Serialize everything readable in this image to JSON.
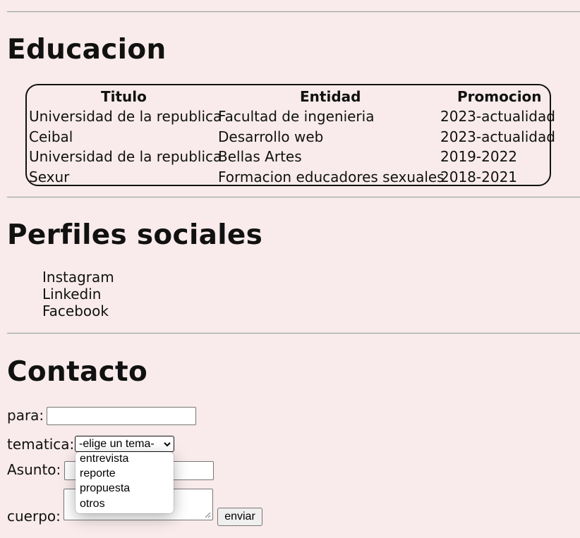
{
  "educacion": {
    "heading": "Educacion",
    "headers": [
      "Titulo",
      "Entidad",
      "Promocion"
    ],
    "rows": [
      [
        "Universidad de la republica",
        "Facultad de ingenieria",
        "2023-actualidad"
      ],
      [
        "Ceibal",
        "Desarrollo web",
        "2023-actualidad"
      ],
      [
        "Universidad de la republica",
        "Bellas Artes",
        "2019-2022"
      ],
      [
        "Sexur",
        "Formacion educadores sexuales",
        "2018-2021"
      ]
    ]
  },
  "perfiles": {
    "heading": "Perfiles sociales",
    "links": [
      "Instagram",
      "Linkedin",
      "Facebook"
    ]
  },
  "contacto": {
    "heading": "Contacto",
    "para_label": "para:",
    "para_value": "",
    "tematica_label": "tematica:",
    "tematica_selected": "-elige un tema-",
    "tematica_options": [
      "entrevista",
      "reporte",
      "propuesta",
      "otros"
    ],
    "asunto_label": "Asunto:",
    "asunto_value": "",
    "cuerpo_label": "cuerpo:",
    "cuerpo_value": "",
    "enviar_label": "enviar"
  },
  "colors": {
    "background": "#f9ebeb",
    "text": "#111111"
  }
}
